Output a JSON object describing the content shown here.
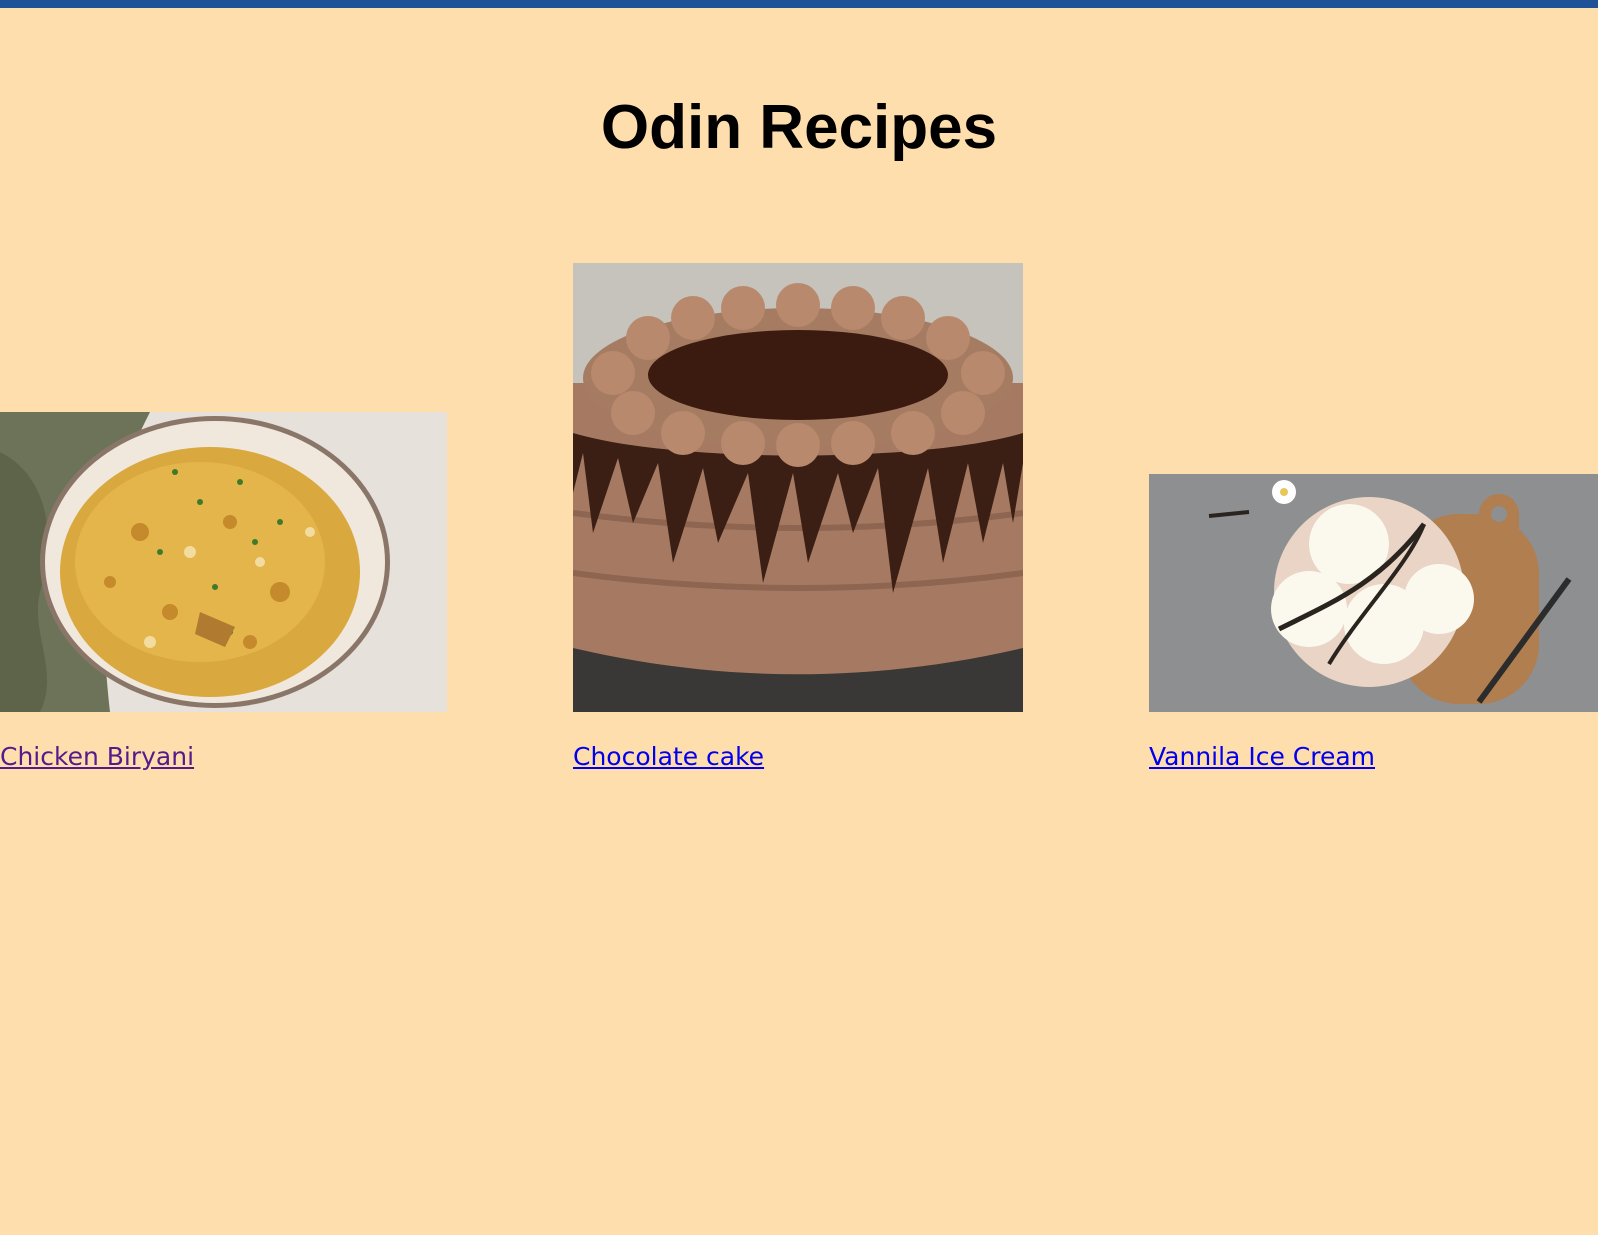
{
  "page": {
    "title": "Odin Recipes",
    "top_bar_color": "#1f5296",
    "background_color": "#ffdead"
  },
  "recipes": [
    {
      "name": "Chicken Biryani",
      "image": "chicken-biryani-bowl",
      "visited": true
    },
    {
      "name": "Chocolate cake",
      "image": "chocolate-drip-cake",
      "visited": false
    },
    {
      "name": "Vannila Ice Cream",
      "image": "vanilla-ice-cream-bowl",
      "visited": false
    }
  ]
}
